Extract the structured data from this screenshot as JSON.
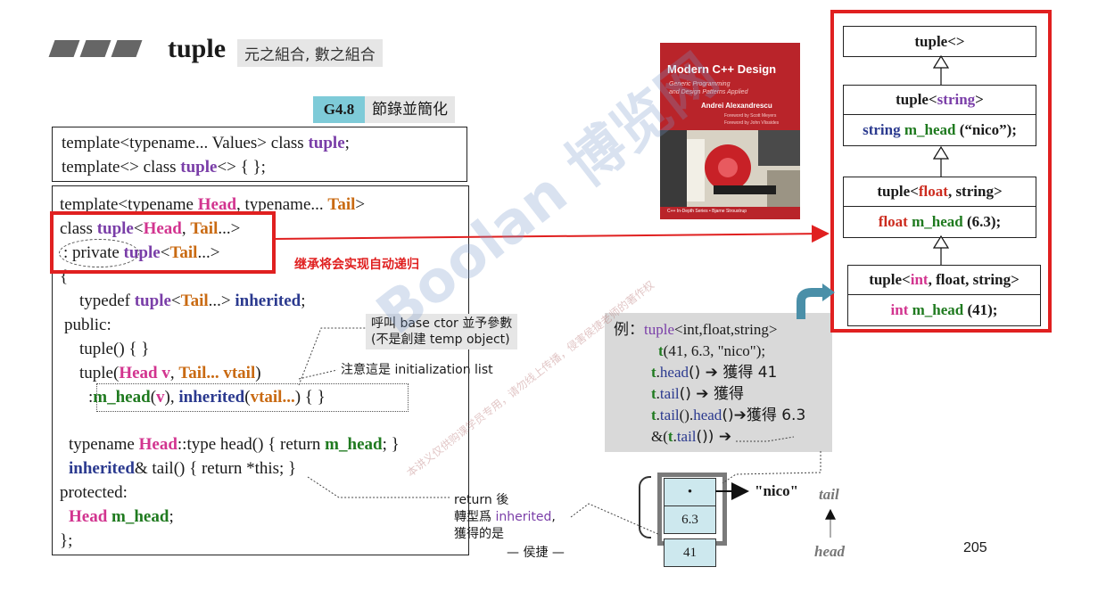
{
  "header": {
    "title": "tuple",
    "subtitle": "元之組合, 數之組合",
    "section_tag": "G4.8",
    "section_note": "節錄並簡化"
  },
  "decl": {
    "line1": [
      "template<typename... Values> class ",
      "tuple",
      ";"
    ],
    "line2": [
      "template<> class ",
      "tuple",
      "<> { };"
    ]
  },
  "code": {
    "l1": [
      "template<typename ",
      "Head",
      ", typename... ",
      "Tail",
      ">"
    ],
    "l2": [
      "class ",
      "tuple",
      "<",
      "Head",
      ", ",
      "Tail",
      "...>"
    ],
    "l3": [
      ": private ",
      "tuple",
      "<",
      "Tail",
      "...>"
    ],
    "l4": "{",
    "l5": [
      "typedef ",
      "tuple",
      "<",
      "Tail",
      "...> ",
      "inherited",
      ";"
    ],
    "l6": "public:",
    "l7": "tuple() { }",
    "l8": [
      "tuple(",
      "Head v",
      ", ",
      "Tail... vtail",
      ")"
    ],
    "l9": [
      ":",
      "m_head",
      "(",
      "v",
      "), ",
      "inherited",
      "(",
      "vtail...",
      ") { }"
    ],
    "l10": [
      "typename ",
      "Head",
      "::type head() { return ",
      "m_head",
      "; }"
    ],
    "l11": [
      "inherited",
      "& tail() { return *this; }"
    ],
    "l12": "protected:",
    "l13": [
      "Head ",
      "m_head",
      ";"
    ],
    "l14": "};"
  },
  "annotations": {
    "recursion": "继承将会实现自动递归",
    "base_ctor_1": "呼叫 base ctor 並予參數",
    "base_ctor_2": "(不是創建 temp object)",
    "init_list": "注意這是 initialization list",
    "return_1": "return 後",
    "return_2a": "轉型爲 ",
    "return_2b": "inherited",
    "return_2c": ",",
    "return_3": "獲得的是",
    "author": "— 侯捷 —"
  },
  "book": {
    "title": "Modern C++ Design",
    "subtitle_1": "Generic Programming",
    "subtitle_2": "and Design Patterns Applied",
    "author": "Andrei Alexandrescu",
    "foreword_1": "Foreword by Scott Meyers",
    "foreword_2": "Foreword by John Vlissides",
    "series": "C++ In-Depth Series • Bjarne Stroustrup"
  },
  "example": {
    "l1a": "例：",
    "l1b": "tuple",
    "l1c": "<int,float,string>",
    "l2a": "t",
    "l2b": "(41, 6.3, \"nico\");",
    "l3a": "t",
    "l3b": ".",
    "l3c": "head",
    "l3d": "() ➔ 獲得 41",
    "l4a": "t",
    "l4b": ".",
    "l4c": "tail",
    "l4d": "() ➔ 獲得",
    "l5a": "t",
    "l5b": ".",
    "l5c": "tail",
    "l5d": "().",
    "l5e": "head",
    "l5f": "()➔獲得 6.3",
    "l6a": "&(",
    "l6b": "t",
    "l6c": ".",
    "l6d": "tail",
    "l6e": "()) ➔"
  },
  "memory": {
    "cells": [
      "•",
      "6.3",
      "41"
    ],
    "pointer_label": "\"nico\"",
    "tail_label": "tail",
    "head_label": "head"
  },
  "hierarchy": {
    "c0": "tuple<>",
    "c1h_a": "tuple<",
    "c1h_b": "string",
    "c1h_c": ">",
    "c1m_a": "string ",
    "c1m_b": "m_head",
    "c1m_c": " (“nico”);",
    "c2h_a": "tuple<",
    "c2h_b": "float",
    "c2h_c": ", string>",
    "c2m_a": "float ",
    "c2m_b": "m_head",
    "c2m_c": " (6.3);",
    "c3h_a": "tuple<",
    "c3h_b": "int",
    "c3h_c": ", float, string>",
    "c3m_a": "int ",
    "c3m_b": "m_head",
    "c3m_c": " (41);"
  },
  "page_number": "205",
  "watermark": {
    "main": "Boolan 博览网",
    "small": "本讲义仅供购课学员专用，请勿线上传播，侵害侯捷老师的著作权"
  },
  "colors": {
    "highlight_red": "#e02020",
    "tag_bg": "#7ecbd8",
    "note_bg": "#e6e6e6",
    "example_bg": "#d9d9d9",
    "cell_bg": "#cde8ee"
  }
}
